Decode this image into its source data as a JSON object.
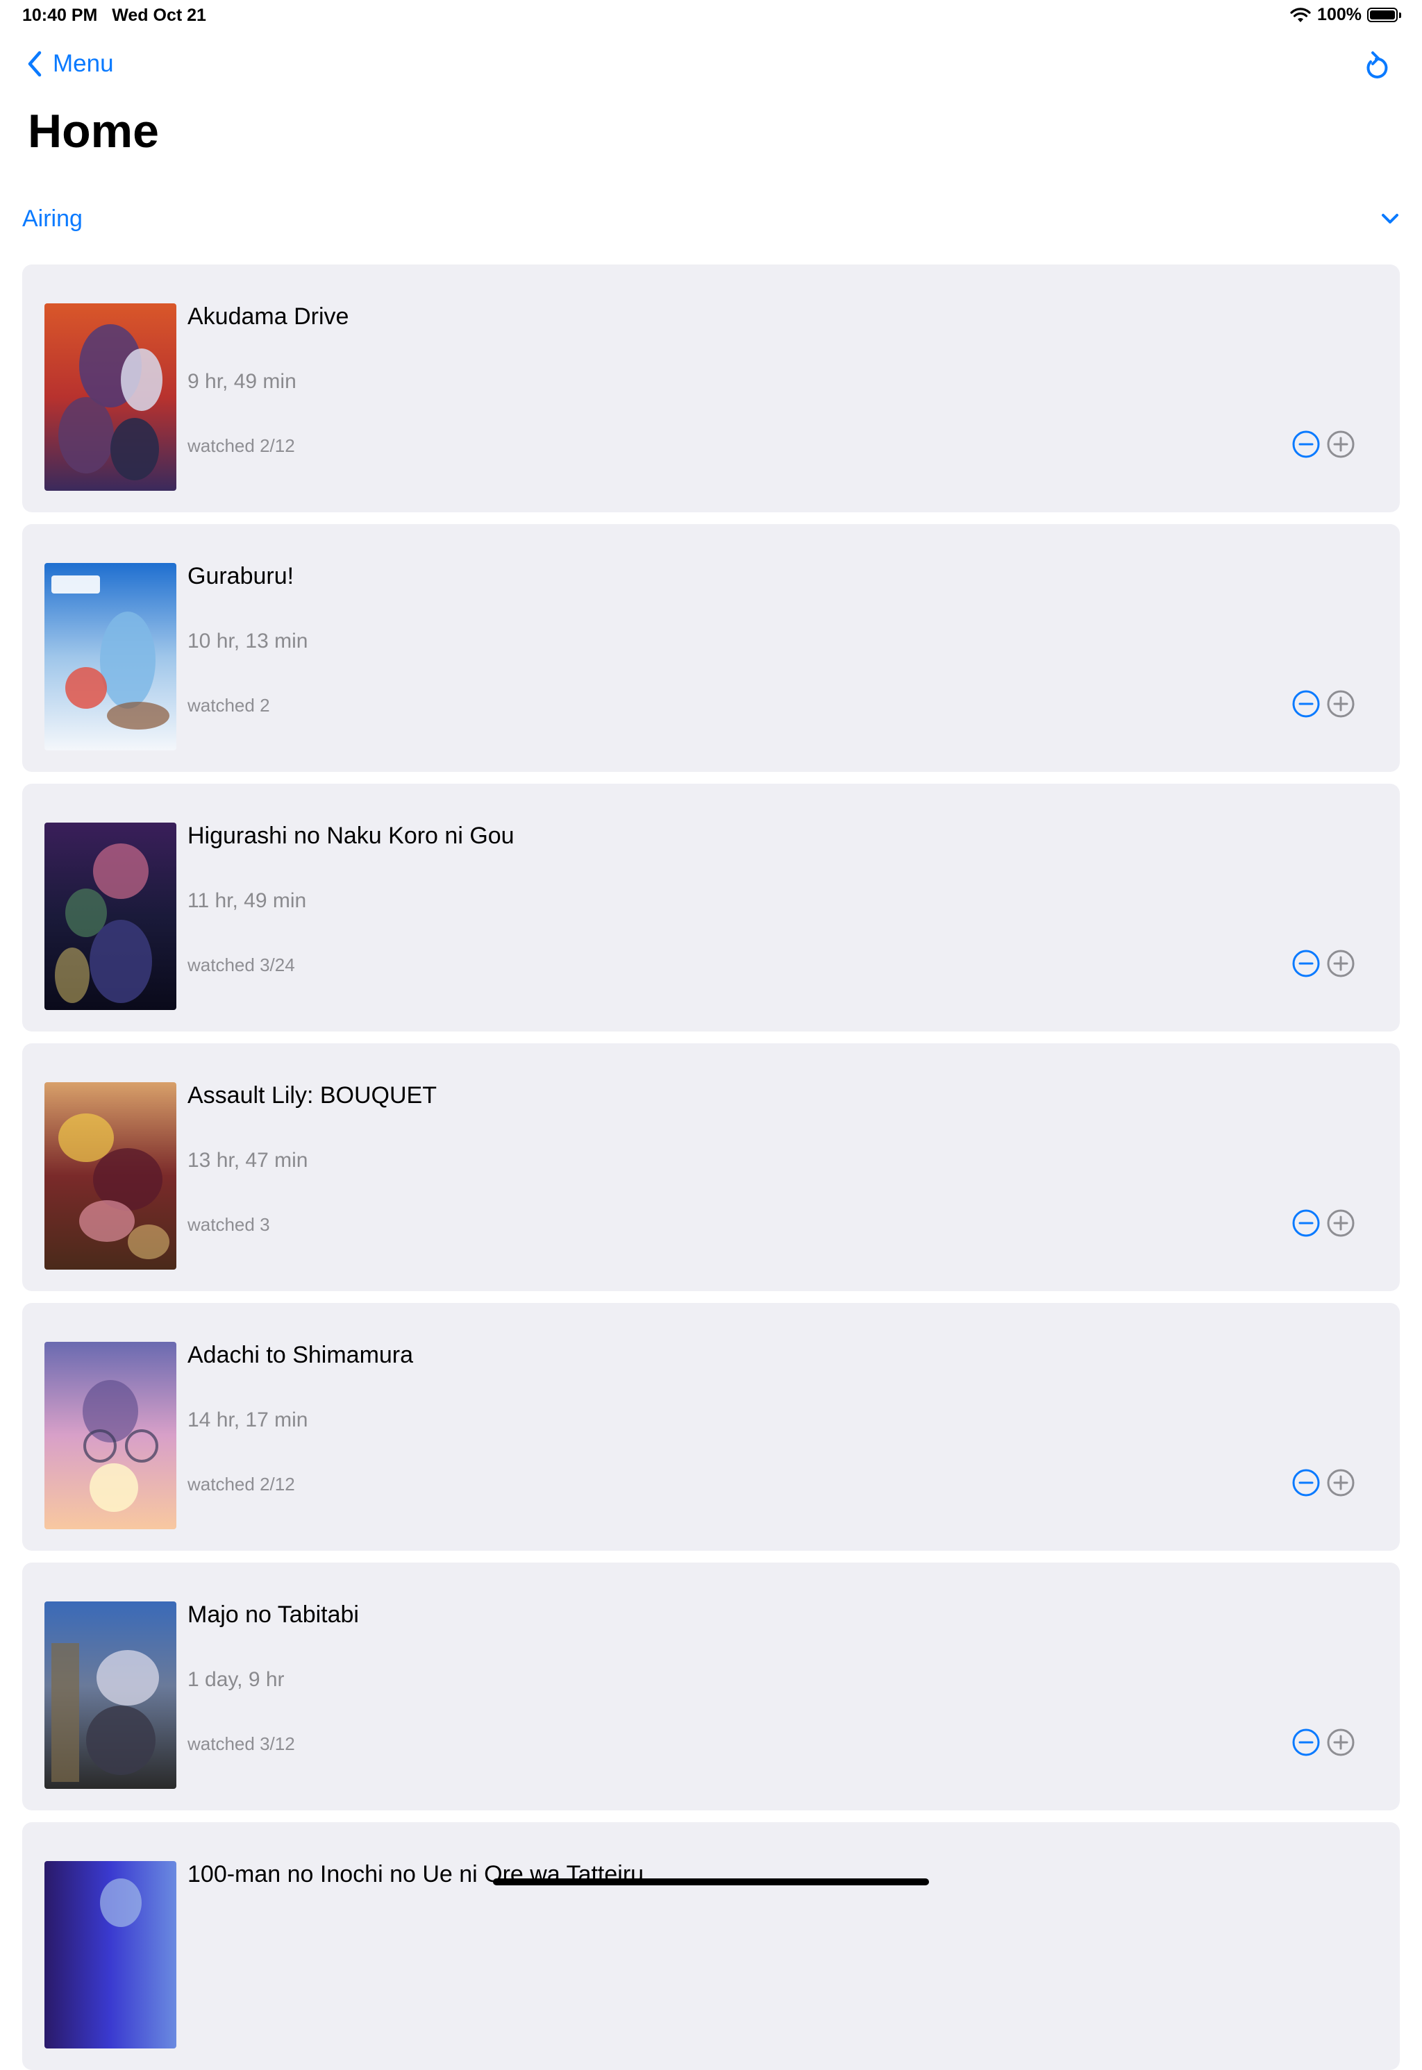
{
  "status_bar": {
    "time": "10:40 PM",
    "date": "Wed Oct 21",
    "battery": "100%",
    "battery_level": 1.0
  },
  "nav": {
    "back_label": "Menu",
    "back_icon": "chevron-left-icon",
    "refresh_icon": "refresh-icon"
  },
  "page": {
    "title": "Home"
  },
  "section": {
    "label": "Airing",
    "icon": "chevron-down-icon"
  },
  "colors": {
    "accent": "#0a7aff",
    "card_bg": "#efeff4",
    "secondary_text": "#8a8a8e",
    "plus_gray": "#8e8e93"
  },
  "shows": [
    {
      "title": "Akudama Drive",
      "time_left": "9 hr, 49 min",
      "watched": "watched 2/12"
    },
    {
      "title": "Guraburu!",
      "time_left": "10 hr, 13 min",
      "watched": "watched 2"
    },
    {
      "title": "Higurashi no Naku Koro ni Gou",
      "time_left": "11 hr, 49 min",
      "watched": "watched 3/24"
    },
    {
      "title": "Assault Lily: BOUQUET",
      "time_left": "13 hr, 47 min",
      "watched": "watched 3"
    },
    {
      "title": "Adachi to Shimamura",
      "time_left": "14 hr, 17 min",
      "watched": "watched 2/12"
    },
    {
      "title": "Majo no Tabitabi",
      "time_left": "1 day, 9 hr",
      "watched": "watched 3/12"
    },
    {
      "title": "100-man no Inochi no Ue ni Ore wa Tatteiru",
      "time_left": "",
      "watched": ""
    }
  ]
}
